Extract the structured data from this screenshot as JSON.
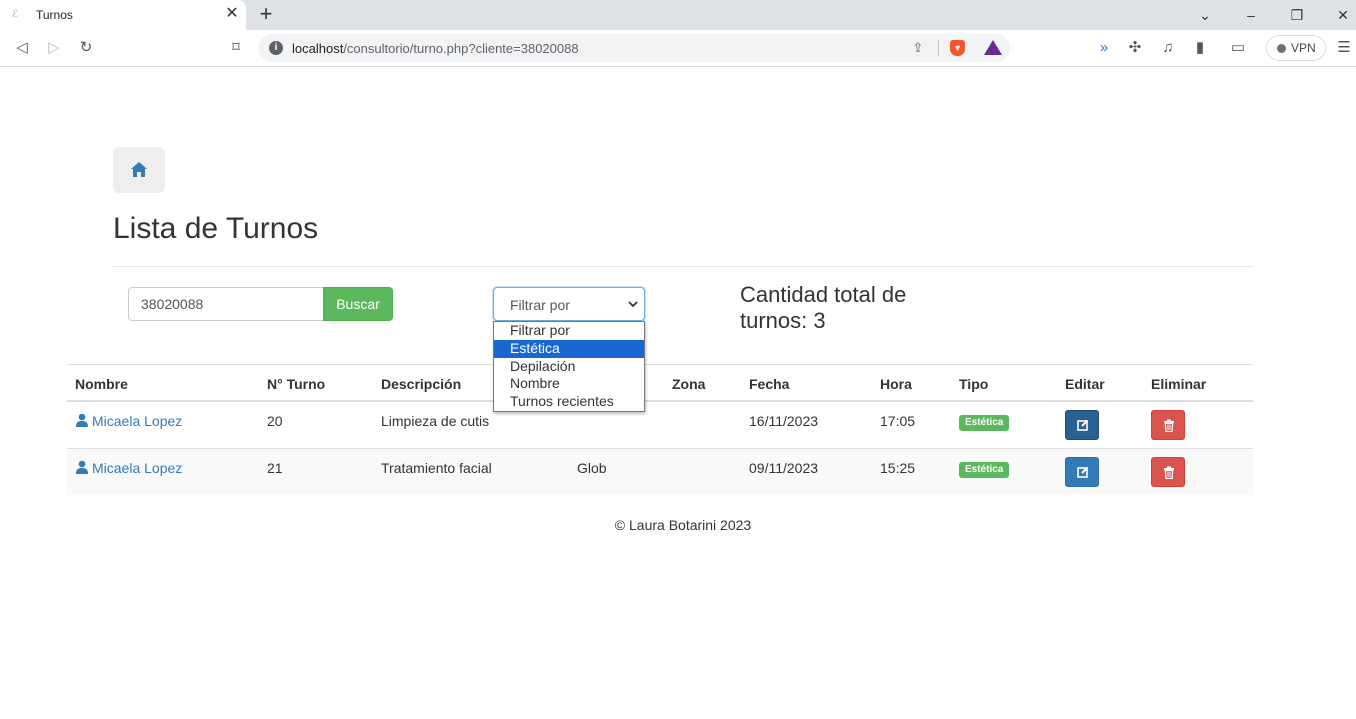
{
  "browser": {
    "tab_title": "Turnos",
    "tab_close": "✕",
    "new_tab": "+",
    "url_host": "localhost",
    "url_path": "/consultorio/turno.php?cliente=38020088",
    "vpn_label": "VPN"
  },
  "page": {
    "title": "Lista de Turnos",
    "search_value": "38020088",
    "search_button": "Buscar",
    "filter_selected": "Filtrar por",
    "filter_options": [
      "Filtrar por",
      "Estética",
      "Depilación",
      "Nombre",
      "Turnos recientes"
    ],
    "filter_highlighted": "Estética",
    "total_label": "Cantidad total de turnos: 3"
  },
  "table": {
    "headers": [
      "Nombre",
      "N° Turno",
      "Descripción",
      "Zona",
      "Fecha",
      "Hora",
      "Tipo",
      "Editar",
      "Eliminar"
    ],
    "rows": [
      {
        "nombre": "Micaela Lopez",
        "turno": "20",
        "descripcion": "Limpieza de cutis",
        "detalle": "",
        "zona": "",
        "fecha": "16/11/2023",
        "hora": "17:05",
        "tipo": "Estética"
      },
      {
        "nombre": "Micaela Lopez",
        "turno": "21",
        "descripcion": "Tratamiento facial",
        "detalle": "Glob",
        "zona": "",
        "fecha": "09/11/2023",
        "hora": "15:25",
        "tipo": "Estética"
      }
    ]
  },
  "footer": {
    "text": "© Laura Botarini 2023"
  },
  "colors": {
    "primary": "#337ab7",
    "success": "#5cb85c",
    "danger": "#d9534f",
    "highlight": "#1967d2"
  },
  "icons": {
    "home": "home-icon",
    "user": "user-icon",
    "edit": "edit-icon",
    "trash": "trash-icon"
  }
}
